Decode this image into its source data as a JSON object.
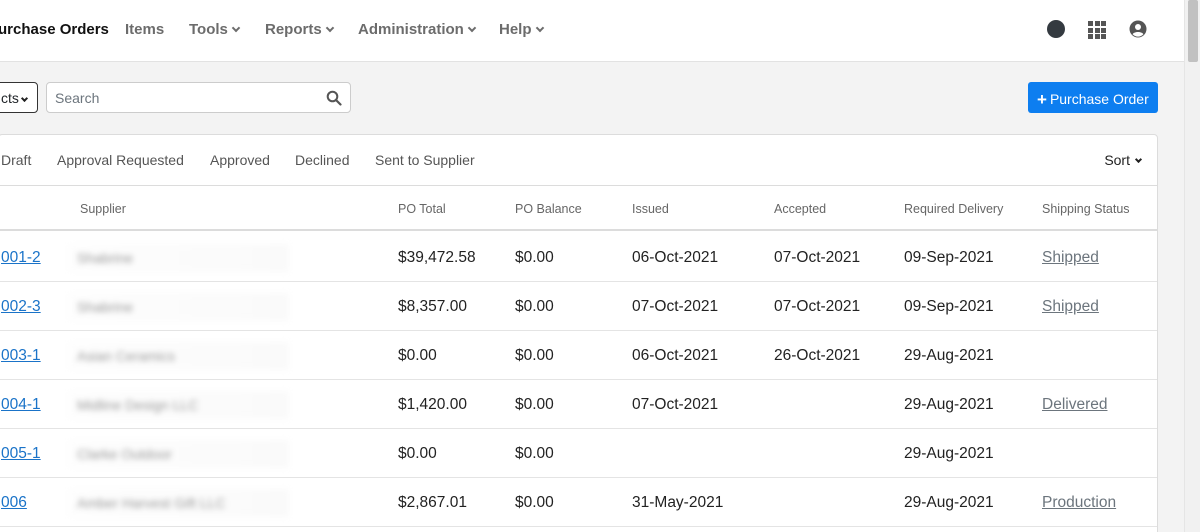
{
  "nav": {
    "items": [
      {
        "label": "urchase Orders",
        "active": true
      },
      {
        "label": "Items",
        "caret": false
      },
      {
        "label": "Tools",
        "caret": true
      },
      {
        "label": "Reports",
        "caret": true
      },
      {
        "label": "Administration",
        "caret": true
      },
      {
        "label": "Help",
        "caret": true
      }
    ]
  },
  "toolbar": {
    "filter_label": "cts",
    "search_placeholder": "Search",
    "new_po_label": "Purchase Order"
  },
  "tabs": [
    "Draft",
    "Approval Requested",
    "Approved",
    "Declined",
    "Sent to Supplier"
  ],
  "sort_label": "Sort",
  "columns": [
    "Supplier",
    "PO Total",
    "PO Balance",
    "Issued",
    "Accepted",
    "Required Delivery",
    "Shipping Status"
  ],
  "rows": [
    {
      "po": "001-2",
      "supplier": "Shabrine",
      "total": "$39,472.58",
      "balance": "$0.00",
      "issued": "06-Oct-2021",
      "accepted": "07-Oct-2021",
      "required": "09-Sep-2021",
      "status": "Shipped"
    },
    {
      "po": "002-3",
      "supplier": "Shabrine",
      "total": "$8,357.00",
      "balance": "$0.00",
      "issued": "07-Oct-2021",
      "accepted": "07-Oct-2021",
      "required": "09-Sep-2021",
      "status": "Shipped"
    },
    {
      "po": "003-1",
      "supplier": "Asian Ceramics",
      "total": "$0.00",
      "balance": "$0.00",
      "issued": "06-Oct-2021",
      "accepted": "26-Oct-2021",
      "required": "29-Aug-2021",
      "status": ""
    },
    {
      "po": "004-1",
      "supplier": "Midline Design LLC",
      "total": "$1,420.00",
      "balance": "$0.00",
      "issued": "07-Oct-2021",
      "accepted": "",
      "required": "29-Aug-2021",
      "status": "Delivered"
    },
    {
      "po": "005-1",
      "supplier": "Clarke Outdoor",
      "total": "$0.00",
      "balance": "$0.00",
      "issued": "",
      "accepted": "",
      "required": "29-Aug-2021",
      "status": ""
    },
    {
      "po": "006",
      "supplier": "Amber Harvest Gift LLC",
      "total": "$2,867.01",
      "balance": "$0.00",
      "issued": "31-May-2021",
      "accepted": "",
      "required": "29-Aug-2021",
      "status": "Production"
    }
  ],
  "colors": {
    "primary": "#0d7ef0",
    "link": "#1a73c8",
    "status_link": "#6c757d"
  },
  "icons": [
    "dark-circle-icon",
    "apps-grid-icon",
    "user-account-icon",
    "search-icon",
    "plus-icon",
    "chevron-down-icon"
  ]
}
